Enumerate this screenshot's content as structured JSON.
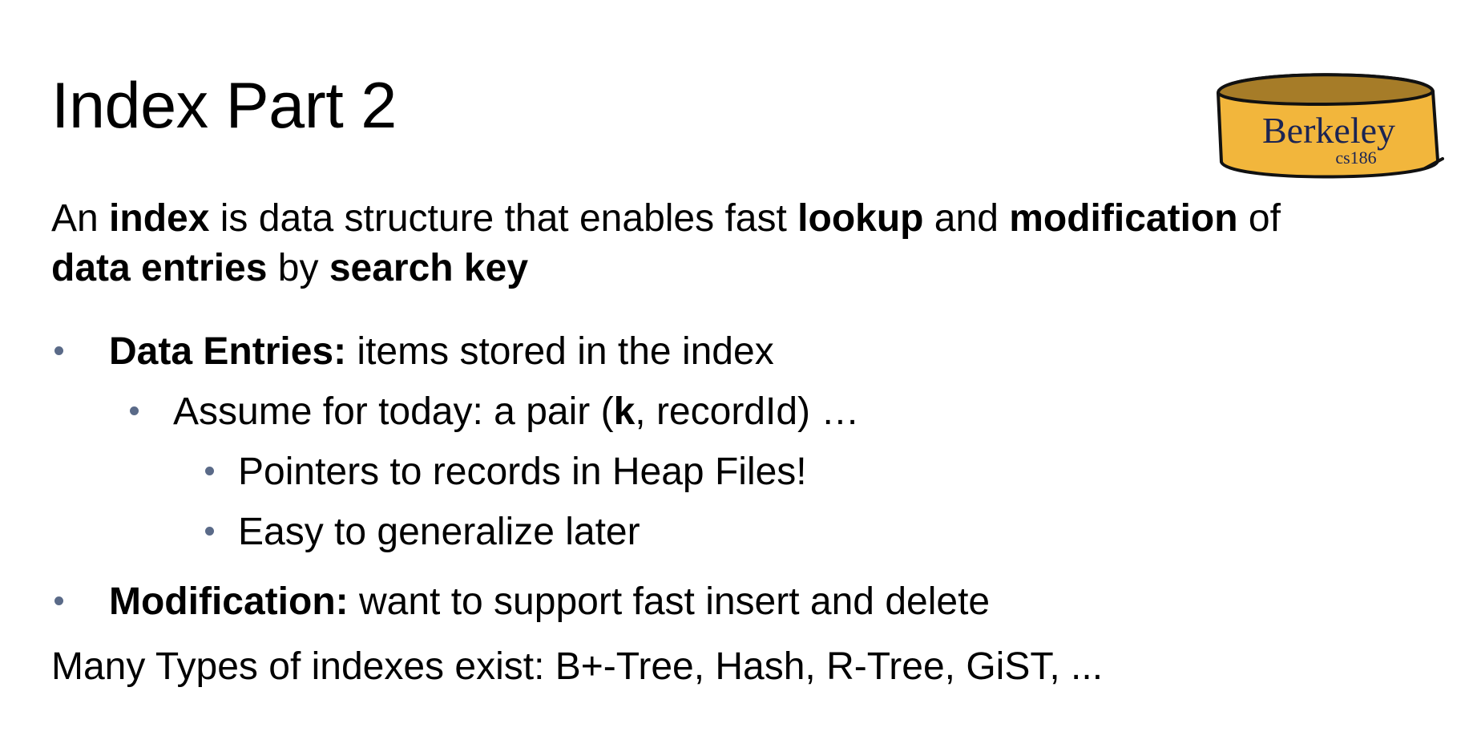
{
  "slide": {
    "title": "Index Part 2",
    "logo": {
      "name": "Berkeley",
      "course": "cs186",
      "fill_color": "#f2b63c",
      "top_color": "#a67c28"
    },
    "intro": {
      "p1": "An ",
      "b1": "index",
      "p2": " is data structure that enables fast ",
      "b2": "lookup",
      "p3": " and ",
      "b3": "modification",
      "p4": " of",
      "b4": "data entries",
      "p5": " by ",
      "b5": "search key"
    },
    "bullets": {
      "data_entries": {
        "term": "Data Entries:",
        "text": " items stored in the index"
      },
      "assume": {
        "text1": "Assume for today: a pair (",
        "bold": "k",
        "text2": ", recordId) …"
      },
      "pointers": {
        "text": "Pointers to records in Heap Files!"
      },
      "generalize": {
        "text": "Easy to generalize later"
      },
      "modification": {
        "term": "Modification:",
        "text": " want to support fast insert and delete"
      }
    },
    "types_line": "Many Types of indexes exist: B+-Tree, Hash, R-Tree, GiST, ..."
  }
}
